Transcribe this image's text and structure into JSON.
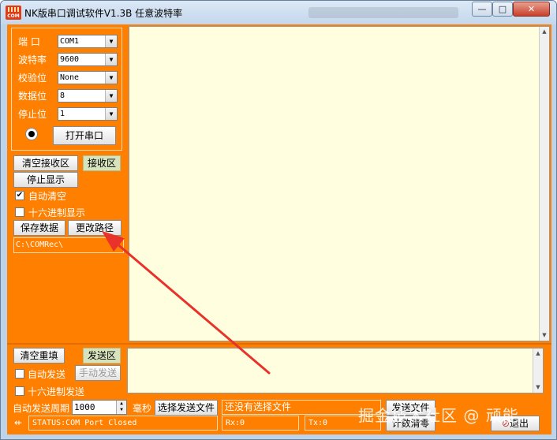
{
  "window": {
    "title": "NK版串口调试软件V1.3B  任意波特率",
    "icon_text": "COM",
    "controls": {
      "minimize": "—",
      "maximize": "□",
      "close": "✕"
    }
  },
  "port_settings": {
    "port_label": "端  口",
    "port_value": "COM1",
    "baud_label": "波特率",
    "baud_value": "9600",
    "parity_label": "校验位",
    "parity_value": "None",
    "databits_label": "数据位",
    "databits_value": "8",
    "stopbits_label": "停止位",
    "stopbits_value": "1",
    "open_button": "打开串口",
    "combo_arrow": "▼"
  },
  "receive": {
    "clear_button": "清空接收区",
    "area_tag": "接收区",
    "stop_button": "停止显示",
    "auto_clear_label": "自动清空",
    "auto_clear_checked": true,
    "hex_display_label": "十六进制显示",
    "hex_display_checked": false,
    "save_button": "保存数据",
    "change_path_button": "更改路径",
    "path_value": "C:\\COMRec\\"
  },
  "send": {
    "clear_button": "清空重填",
    "area_tag": "发送区",
    "auto_send_label": "自动发送",
    "manual_send_button": "手动发送",
    "hex_send_label": "十六进制发送",
    "period_label": "自动发送周期",
    "period_value": "1000",
    "period_unit": "毫秒",
    "select_file_button": "选择发送文件",
    "file_status": "还没有选择文件",
    "send_file_button": "发送文件",
    "clear_count_button": "计数清零",
    "exit_button": "退出"
  },
  "status_bar": {
    "status": "STATUS:COM Port Closed",
    "rx": "Rx:0",
    "tx": "Tx:0",
    "pin_icon": "⇷"
  },
  "watermark": "掘金技术社区 @ 顽能",
  "colors": {
    "panel_bg": "#ff8000",
    "text_area_bg": "#ffffe0",
    "tag_bg": "#d7e3bc",
    "annotation_arrow": "#e8322a"
  }
}
